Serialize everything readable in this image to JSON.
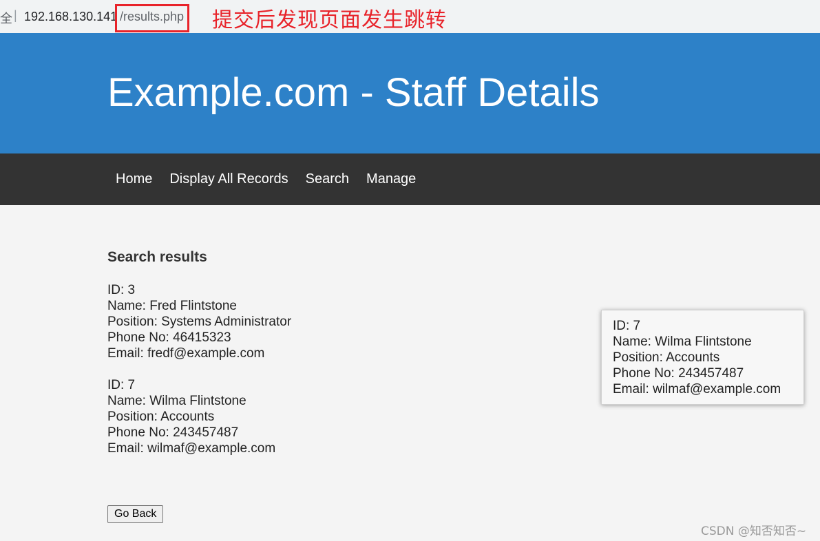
{
  "browser": {
    "secure_label": "全",
    "separator": "|",
    "host": "192.168.130.141",
    "path": "/results.php"
  },
  "annotation": "提交后发现页面发生跳转",
  "header": {
    "title": "Example.com - Staff Details"
  },
  "nav": {
    "items": [
      {
        "label": "Home"
      },
      {
        "label": "Display All Records"
      },
      {
        "label": "Search"
      },
      {
        "label": "Manage"
      }
    ]
  },
  "results": {
    "heading": "Search results",
    "records": [
      {
        "id": "ID: 3",
        "name": "Name: Fred Flintstone",
        "position": "Position: Systems Administrator",
        "phone": "Phone No: 46415323",
        "email": "Email: fredf@example.com"
      },
      {
        "id": "ID: 7",
        "name": "Name: Wilma Flintstone",
        "position": "Position: Accounts",
        "phone": "Phone No: 243457487",
        "email": "Email: wilmaf@example.com"
      }
    ]
  },
  "popup": {
    "id": "ID: 7",
    "name": "Name: Wilma Flintstone",
    "position": "Position: Accounts",
    "phone": "Phone No: 243457487",
    "email": "Email: wilmaf@example.com"
  },
  "go_back_label": "Go Back",
  "watermark": "CSDN @知否知否~",
  "colors": {
    "header_bg": "#2d81c8",
    "nav_bg": "#333333",
    "annotation_red": "#e8232a",
    "page_bg": "#f4f4f4"
  }
}
